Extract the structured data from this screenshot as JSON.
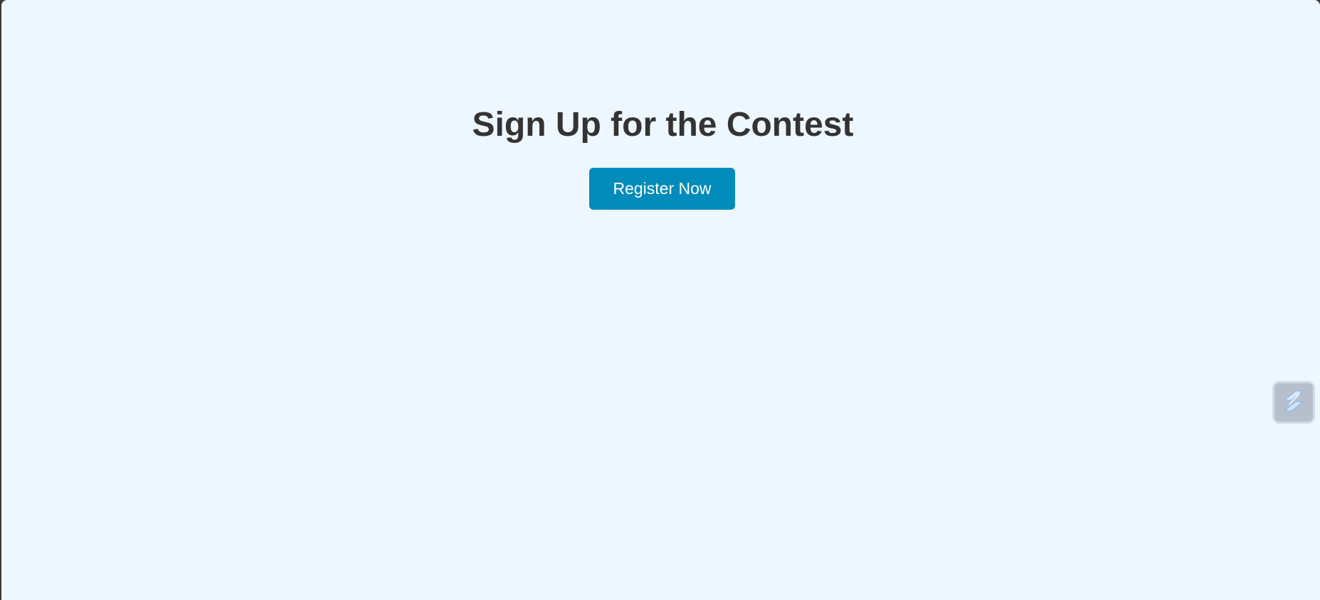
{
  "main": {
    "title": "Sign Up for the Contest",
    "register_button_label": "Register Now"
  },
  "widget": {
    "icon": "extension-icon"
  },
  "colors": {
    "background": "#eef7ff",
    "button": "#008cba",
    "title": "#333333"
  }
}
